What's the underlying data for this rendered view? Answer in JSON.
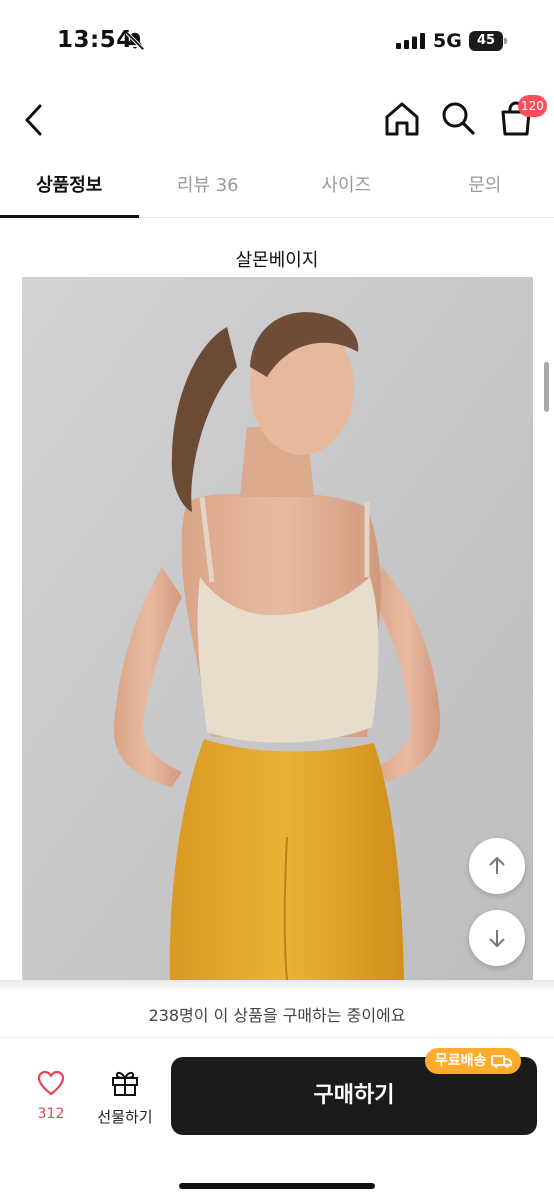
{
  "status_bar": {
    "time": "13:54",
    "network": "5G",
    "battery": "45",
    "icons": [
      "bell-slash-icon",
      "signal-bars-icon",
      "battery-icon"
    ]
  },
  "header": {
    "icons": [
      "back-chevron-icon",
      "home-icon",
      "search-icon",
      "shopping-bag-icon"
    ],
    "cart_count": "120",
    "badge_color": "#ff4d5e"
  },
  "tabs": [
    {
      "label": "상품정보",
      "active": true
    },
    {
      "label": "리뷰 36",
      "active": false
    },
    {
      "label": "사이즈",
      "active": false
    },
    {
      "label": "문의",
      "active": false
    }
  ],
  "product": {
    "color_caption": "살몬베이지",
    "image_description_icon": "product-photo"
  },
  "floating_buttons": [
    "arrow-up-icon",
    "arrow-down-icon"
  ],
  "bottom_bar": {
    "notice": "238명이 이 상품을 구매하는 중이에요",
    "like_count": "312",
    "gift_label": "선물하기",
    "buy_label": "구매하기",
    "shipping_badge": "무료배송",
    "accent_color": "#ffab2e",
    "like_color": "#e0455a",
    "buy_button_color": "#1b1b1b"
  }
}
